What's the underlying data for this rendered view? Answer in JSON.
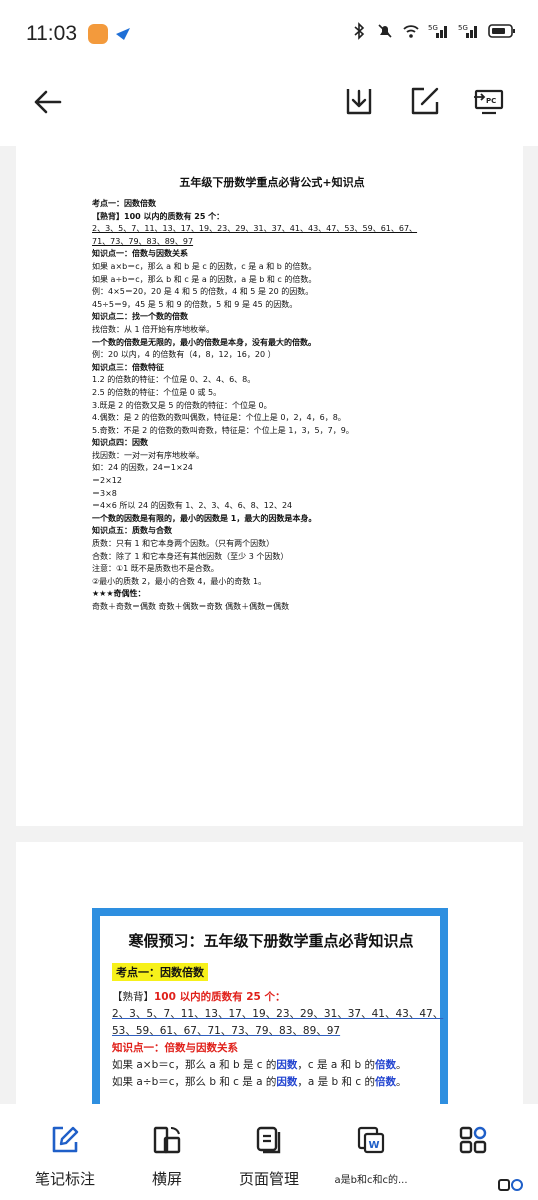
{
  "status": {
    "time": "11:03"
  },
  "doc1": {
    "title": "五年级下册数学重点必背公式+知识点",
    "lines": [
      {
        "text": "考点一：因数倍数",
        "cls": "bold"
      },
      {
        "text": "【熟背】100 以内的质数有 25 个：",
        "cls": "bold"
      },
      {
        "text": "2、3、5、7、11、13、17、19、23、29、31、37、41、43、47、53、59、61、67、",
        "cls": "ul"
      },
      {
        "text": "71、73、79、83、89、97",
        "cls": "ul"
      },
      {
        "text": "知识点一：倍数与因数关系",
        "cls": "bold"
      },
      {
        "text": "如果 a×b＝c，那么 a 和 b 是 c 的因数，c 是 a 和 b 的倍数。",
        "cls": ""
      },
      {
        "text": "如果 a÷b＝c，那么 b 和 c 是 a 的因数，a 是 b 和 c 的倍数。",
        "cls": ""
      },
      {
        "text": "例：4×5＝20，20 是 4 和 5 的倍数，4 和 5 是 20 的因数。",
        "cls": ""
      },
      {
        "text": "45÷5＝9，45 是 5 和 9 的倍数，5 和 9 是 45 的因数。",
        "cls": ""
      },
      {
        "text": "知识点二：找一个数的倍数",
        "cls": "bold"
      },
      {
        "text": "找倍数：从 1 倍开始有序地枚举。",
        "cls": ""
      },
      {
        "text": "一个数的倍数是无限的，最小的倍数是本身，没有最大的倍数。",
        "cls": "bold"
      },
      {
        "text": "例：20 以内，4 的倍数有（4，8，12，16，20 ）",
        "cls": ""
      },
      {
        "text": "知识点三：倍数特征",
        "cls": "bold"
      },
      {
        "text": "1.2 的倍数的特征：个位是 0、2、4、6、8。",
        "cls": ""
      },
      {
        "text": "2.5 的倍数的特征：个位是 0 或 5。",
        "cls": ""
      },
      {
        "text": "3.既是 2 的倍数又是 5 的倍数的特征：个位是 0。",
        "cls": ""
      },
      {
        "text": "4.偶数：是 2 的倍数的数叫偶数，特征是：个位上是 0，2，4，6，8。",
        "cls": ""
      },
      {
        "text": "5.奇数：不是 2 的倍数的数叫奇数，特征是：个位上是 1，3，5，7，9。",
        "cls": ""
      },
      {
        "text": "知识点四：因数",
        "cls": "bold"
      },
      {
        "text": "找因数：一对一对有序地枚举。",
        "cls": ""
      },
      {
        "text": "如：24 的因数，24＝1×24",
        "cls": ""
      },
      {
        "text": "＝2×12",
        "cls": ""
      },
      {
        "text": "＝3×8",
        "cls": ""
      },
      {
        "text": "＝4×6    所以 24 的因数有 1、2、3、4、6、8、12、24",
        "cls": ""
      },
      {
        "text": "一个数的因数是有限的，最小的因数是 1，最大的因数是本身。",
        "cls": "bold"
      },
      {
        "text": "知识点五：质数与合数",
        "cls": "bold"
      },
      {
        "text": "质数：只有 1 和它本身两个因数。（只有两个因数）",
        "cls": ""
      },
      {
        "text": "合数：除了 1 和它本身还有其他因数（至少 3 个因数）",
        "cls": ""
      },
      {
        "text": "注意：①1 既不是质数也不是合数。",
        "cls": ""
      },
      {
        "text": "②最小的质数 2，最小的合数 4，最小的奇数 1。",
        "cls": ""
      },
      {
        "text": "★★★奇偶性：",
        "cls": "bold"
      },
      {
        "text": "奇数＋奇数＝偶数     奇数＋偶数＝奇数     偶数＋偶数＝偶数",
        "cls": ""
      }
    ]
  },
  "doc2": {
    "title": "寒假预习：五年级下册数学重点必背知识点",
    "section": "考点一：因数倍数",
    "prime_head_1": "【熟背】",
    "prime_head_2": "100 以内的质数有 25 个：",
    "primes_1": "2、3、5、7、11、13、17、19、23、29、31、37、41、43、47、",
    "primes_2": "53、59、61、67、71、73、79、83、89、97",
    "kp1": "知识点一：倍数与因数关系",
    "r1a": "如果 a×b＝c，那么 a 和 b 是 c 的",
    "r1b": "因数",
    "r1c": "，c 是 a 和 b 的",
    "r1d": "倍数",
    "r1e": "。",
    "r2a": "如果 a÷b＝c，那么 b 和 c 是 a 的",
    "r2b": "因数",
    "r2c": "，a 是 b 和 c 的",
    "r2d": "倍数",
    "r2e": "。"
  },
  "nav": [
    {
      "label": "笔记标注",
      "icon": "edit-note-icon"
    },
    {
      "label": "横屏",
      "icon": "rotate-screen-icon"
    },
    {
      "label": "页面管理",
      "icon": "page-manage-icon"
    },
    {
      "label": "a是b和c和c的...",
      "icon": "word-doc-icon"
    },
    {
      "label": "",
      "icon": "apps-grid-icon"
    }
  ],
  "colors": {
    "card_border": "#2e8fe0",
    "highlight": "#f7f11a",
    "red": "#e0201a",
    "blue": "#2244d0"
  }
}
